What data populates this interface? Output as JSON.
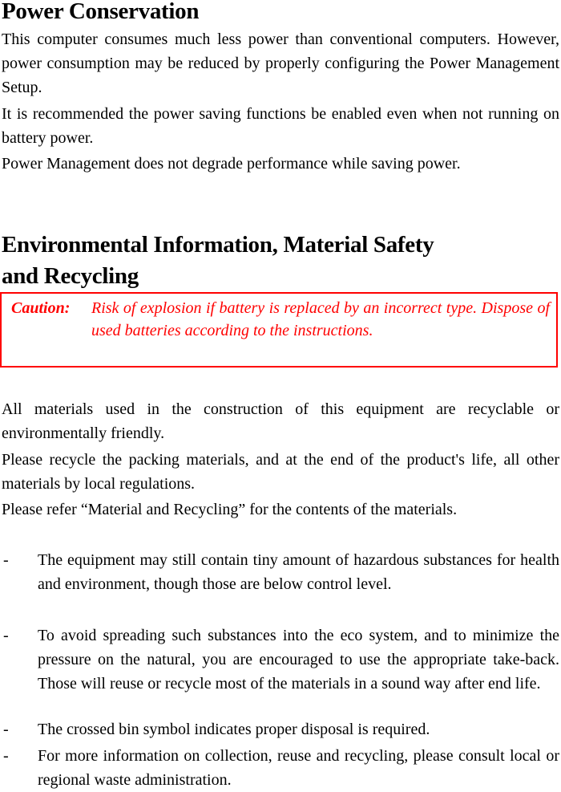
{
  "section1": {
    "title": "Power Conservation",
    "paragraphs": [
      "This computer consumes much less power than conventional computers. However, power consumption may be reduced by properly configuring the Power Management Setup.",
      "It is recommended the power saving functions be enabled even when not running on battery power.",
      "Power Management does not degrade performance while saving power."
    ]
  },
  "section2": {
    "title_line1": "Environmental Information, Material Safety",
    "title_line2": "and Recycling",
    "caution": {
      "label": "Caution:",
      "text": "Risk of explosion if battery is replaced by an incorrect type. Dispose of used batteries according to the instructions.",
      "color": "#ff0000"
    },
    "paragraphs": [
      "All materials used in the construction of this equipment are recyclable or environmentally friendly.",
      "Please recycle the packing materials, and at the end of the product's life, all other materials by local regulations.",
      "Please refer “Material and Recycling” for the contents of the materials."
    ],
    "bullets": [
      {
        "marker": "-",
        "text": "The equipment may still contain tiny amount of hazardous substances for health and environment, though those are below control level."
      },
      {
        "marker": "-",
        "text": "To avoid spreading such substances into the eco system, and to minimize the pressure on the natural, you are encouraged to use the appropriate take-back. Those will reuse or recycle most of the materials in a sound way after end life."
      },
      {
        "marker": "-",
        "text": "The crossed bin symbol indicates proper disposal is required."
      },
      {
        "marker": "-",
        "text": "For more information on collection, reuse and recycling, please consult local or regional waste administration."
      }
    ]
  }
}
